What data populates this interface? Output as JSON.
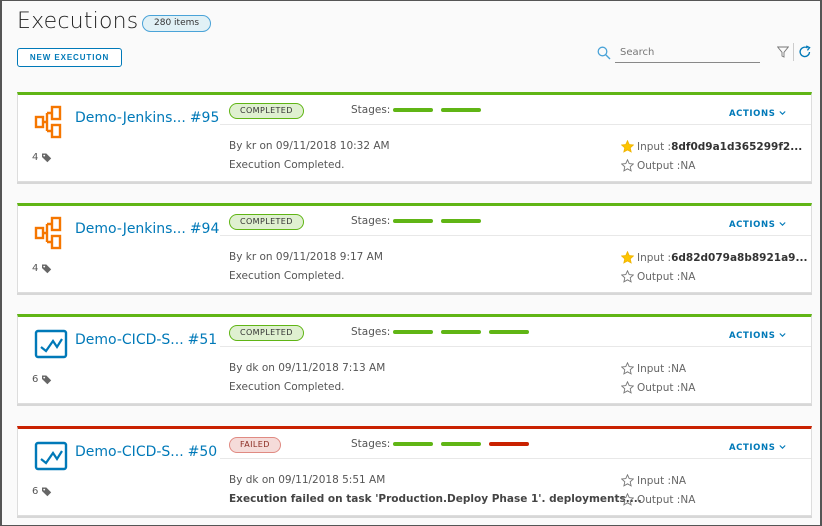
{
  "header": {
    "title": "Executions",
    "count_badge": "280 items",
    "new_button": "NEW EXECUTION",
    "search_placeholder": "Search",
    "search_value": ""
  },
  "colors": {
    "accent": "#0079b8",
    "success": "#60b515",
    "failure": "#c92100",
    "pipeline_orange": "#f57600"
  },
  "executions": [
    {
      "icon": "pipeline-flow-icon",
      "name": "Demo-Jenkins...",
      "number": "#95",
      "tags_count": "4",
      "status": "COMPLETED",
      "stages_label": "Stages:",
      "stages": [
        "success",
        "success"
      ],
      "actions_label": "ACTIONS",
      "by": "By kr on 09/11/2018 10:32 AM",
      "message": "Execution Completed.",
      "input_label": "Input : ",
      "input_value": "8df0d9a1d365299f2...",
      "input_starred": true,
      "output_label": "Output : ",
      "output_value": "NA",
      "output_starred": false
    },
    {
      "icon": "pipeline-flow-icon",
      "name": "Demo-Jenkins...",
      "number": "#94",
      "tags_count": "4",
      "status": "COMPLETED",
      "stages_label": "Stages:",
      "stages": [
        "success",
        "success"
      ],
      "actions_label": "ACTIONS",
      "by": "By kr on 09/11/2018 9:17 AM",
      "message": "Execution Completed.",
      "input_label": "Input : ",
      "input_value": "6d82d079a8b8921a9...",
      "input_starred": true,
      "output_label": "Output : ",
      "output_value": "NA",
      "output_starred": false
    },
    {
      "icon": "pipeline-chart-icon",
      "name": "Demo-CICD-S...",
      "number": "#51",
      "tags_count": "6",
      "status": "COMPLETED",
      "stages_label": "Stages:",
      "stages": [
        "success",
        "success",
        "success"
      ],
      "actions_label": "ACTIONS",
      "by": "By dk  on 09/11/2018 7:13 AM",
      "message": "Execution Completed.",
      "input_label": "Input : ",
      "input_value": "NA",
      "input_starred": false,
      "output_label": "Output : ",
      "output_value": "NA",
      "output_starred": false
    },
    {
      "icon": "pipeline-chart-icon",
      "name": "Demo-CICD-S...",
      "number": "#50",
      "tags_count": "6",
      "status": "FAILED",
      "stages_label": "Stages:",
      "stages": [
        "success",
        "success",
        "failed"
      ],
      "actions_label": "ACTIONS",
      "by": "By dk  on 09/11/2018 5:51 AM",
      "message": "Execution failed on task 'Production.Deploy Phase 1'. deployments....",
      "input_label": "Input : ",
      "input_value": "NA",
      "input_starred": false,
      "output_label": "Output : ",
      "output_value": "NA",
      "output_starred": false
    }
  ]
}
